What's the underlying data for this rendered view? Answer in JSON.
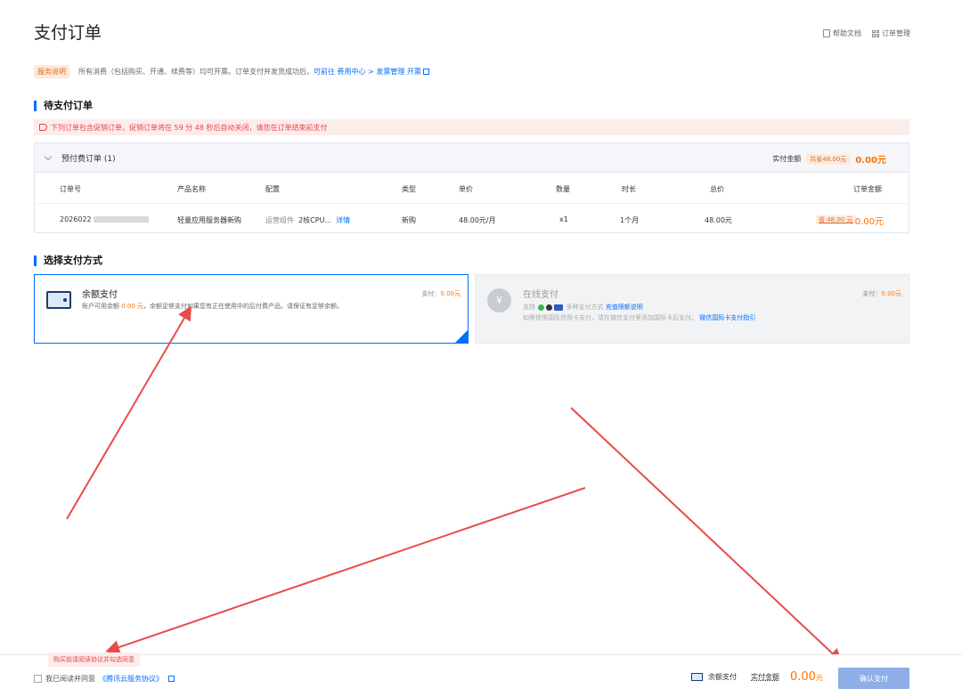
{
  "page": {
    "title": "支付订单",
    "help_doc": "帮助文档",
    "order_manage": "订单管理"
  },
  "notice": {
    "tag": "服务说明",
    "text": "所有消费（包括购买、开通、续费等）均可开票。订单支付并发货成功后，",
    "link_prefix": "可前往",
    "link_path": "费用中心 > 发票管理 开票"
  },
  "pending": {
    "title": "待支付订单",
    "warning": "下列订单包含促销订单，促销订单将在 59 分 48 秒后自动关闭，请您在订单结束前支付",
    "group_title": "预付费订单 (1)",
    "pay_amount_label": "实付金额",
    "discount_badge": "共省48.00元",
    "pay_amount": "0.00元",
    "columns": [
      "订单号",
      "产品名称",
      "配置",
      "类型",
      "单价",
      "数量",
      "时长",
      "总价",
      "订单金额"
    ],
    "row": {
      "order_no": "2026022",
      "product": "轻量应用服务器新购",
      "config_label": "运营组件",
      "config_value": "2核CPU...",
      "detail": "详情",
      "type": "新购",
      "unit_price": "48.00元/月",
      "qty": "x1",
      "duration": "1个月",
      "total": "48.00元",
      "discount": "省 48.00 元",
      "amount": "0.00元"
    }
  },
  "payment": {
    "title": "选择支付方式",
    "balance": {
      "name": "余额支付",
      "desc_prefix": "账户可用余额",
      "balance": "0.00 元",
      "desc_suffix": "，余额足够支付如果您有正在使用中的后付费产品，请保证有足够余额。",
      "pay_label": "支付：",
      "pay_amount": "0.00元"
    },
    "online": {
      "name": "在线支付",
      "support": "支持",
      "methods_text": "多种支付方式",
      "limit_link": "充值限额说明",
      "note": "如需使用国际信用卡支付，请在微信支付里添加国际卡后支付。",
      "note_link": "微信国际卡支付指引",
      "pay_label": "支付：",
      "pay_amount": "0.00元"
    }
  },
  "footer": {
    "tip": "购买前请阅读协议并勾选同意",
    "agree_prefix": "我已阅读并同意",
    "agree_link": "《腾讯云服务协议》",
    "method": "余额支付",
    "amount_label": "实付金额",
    "amount_value": "0.00",
    "amount_unit": "元",
    "confirm": "确认支付"
  },
  "colors": {
    "accent": "#006eff",
    "price": "#ff7200",
    "warning": "#e54545",
    "arrow": "#e74c4c"
  }
}
